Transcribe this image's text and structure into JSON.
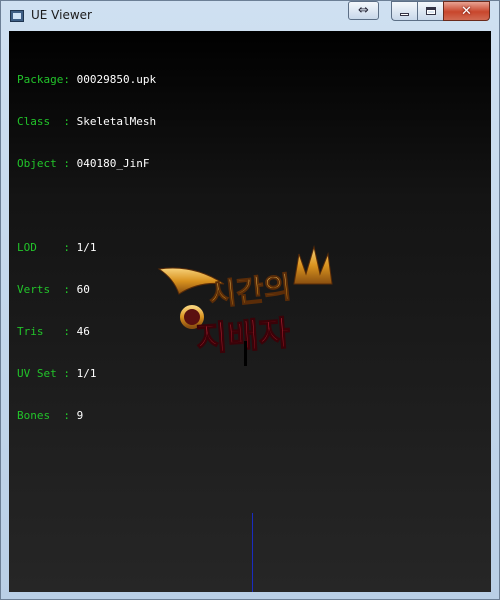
{
  "window": {
    "title": "UE Viewer",
    "extra_button_glyph": "⇔",
    "close_glyph": "✕"
  },
  "info": {
    "package_label": "Package:",
    "package_value": "00029850.upk",
    "class_label": "Class  :",
    "class_value": "SkeletalMesh",
    "object_label": "Object :",
    "object_value": "040180_JinF",
    "lod_label": "LOD    :",
    "lod_value": "1/1",
    "verts_label": "Verts  :",
    "verts_value": "60",
    "tris_label": "Tris   :",
    "tris_value": "46",
    "uvset_label": "UV Set :",
    "uvset_value": "1/1",
    "bones_label": "Bones  :",
    "bones_value": "9"
  },
  "logo": {
    "line1": "시간의",
    "line2": "지배자"
  },
  "colors": {
    "label_green": "#22c42a",
    "value_white": "#ffffff",
    "logo_red": "#b3121f",
    "logo_gold": "#e0a22a",
    "axis_blue": "#1a2cc0"
  }
}
